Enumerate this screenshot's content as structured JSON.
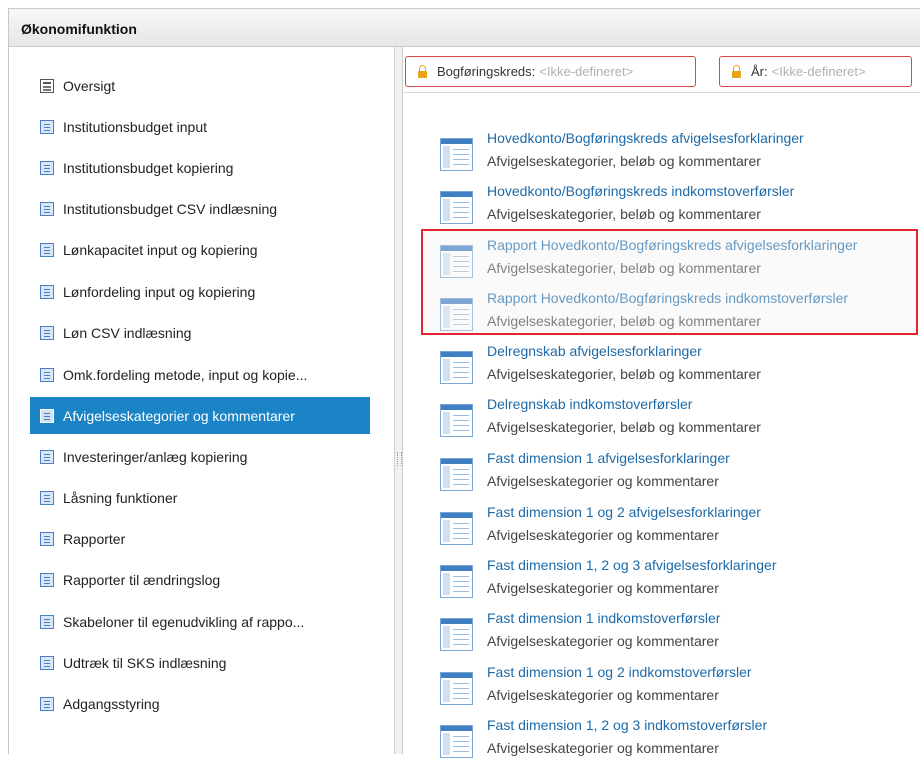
{
  "header": {
    "title": "Økonomifunktion"
  },
  "nav": {
    "items": [
      {
        "label": "Oversigt",
        "icon": "overview-icon"
      },
      {
        "label": "Institutionsbudget input",
        "icon": "document-icon"
      },
      {
        "label": "Institutionsbudget kopiering",
        "icon": "document-icon"
      },
      {
        "label": "Institutionsbudget CSV indlæsning",
        "icon": "document-icon"
      },
      {
        "label": "Lønkapacitet input og kopiering",
        "icon": "document-icon"
      },
      {
        "label": "Lønfordeling input og kopiering",
        "icon": "document-icon"
      },
      {
        "label": "Løn CSV indlæsning",
        "icon": "document-icon"
      },
      {
        "label": "Omk.fordeling metode, input og kopie...",
        "icon": "document-icon"
      },
      {
        "label": "Afvigelseskategorier og kommentarer",
        "icon": "document-icon",
        "active": true
      },
      {
        "label": "Investeringer/anlæg kopiering",
        "icon": "document-icon"
      },
      {
        "label": "Låsning funktioner",
        "icon": "document-icon"
      },
      {
        "label": "Rapporter",
        "icon": "document-icon"
      },
      {
        "label": "Rapporter til ændringslog",
        "icon": "document-icon"
      },
      {
        "label": "Skabeloner til egenudvikling af rappo...",
        "icon": "document-icon"
      },
      {
        "label": "Udtræk til SKS indlæsning",
        "icon": "document-icon"
      },
      {
        "label": "Adgangsstyring",
        "icon": "document-icon"
      }
    ]
  },
  "filters": {
    "bogforingskreds": {
      "label": "Bogføringskreds:",
      "value": "<Ikke-defineret>"
    },
    "aar": {
      "label": "År:",
      "value": "<Ikke-defineret>"
    }
  },
  "entries": [
    {
      "title": "Hovedkonto/Bogføringskreds afvigelsesforklaringer",
      "subtitle": "Afvigelseskategorier, beløb og kommentarer"
    },
    {
      "title": "Hovedkonto/Bogføringskreds indkomstoverførsler",
      "subtitle": "Afvigelseskategorier, beløb og kommentarer"
    },
    {
      "title": "Rapport Hovedkonto/Bogføringskreds afvigelsesforklaringer",
      "subtitle": "Afvigelseskategorier, beløb og kommentarer"
    },
    {
      "title": "Rapport Hovedkonto/Bogføringskreds indkomstoverførsler",
      "subtitle": "Afvigelseskategorier, beløb og kommentarer"
    },
    {
      "title": "Delregnskab afvigelsesforklaringer",
      "subtitle": "Afvigelseskategorier, beløb og kommentarer"
    },
    {
      "title": "Delregnskab indkomstoverførsler",
      "subtitle": "Afvigelseskategorier, beløb og kommentarer"
    },
    {
      "title": "Fast dimension 1 afvigelsesforklaringer",
      "subtitle": "Afvigelseskategorier og kommentarer"
    },
    {
      "title": "Fast dimension 1 og 2 afvigelsesforklaringer",
      "subtitle": "Afvigelseskategorier og kommentarer"
    },
    {
      "title": "Fast dimension 1, 2 og 3 afvigelsesforklaringer",
      "subtitle": "Afvigelseskategorier og kommentarer"
    },
    {
      "title": "Fast dimension 1 indkomstoverførsler",
      "subtitle": "Afvigelseskategorier og kommentarer"
    },
    {
      "title": "Fast dimension 1 og 2 indkomstoverførsler",
      "subtitle": "Afvigelseskategorier og kommentarer"
    },
    {
      "title": "Fast dimension 1, 2 og 3 indkomstoverførsler",
      "subtitle": "Afvigelseskategorier og kommentarer"
    }
  ],
  "colors": {
    "accent": "#1a84c6",
    "link": "#1d6aa9",
    "highlight": "#e0262f",
    "filter_border": "#d24848",
    "lock": "#e7a41b"
  }
}
